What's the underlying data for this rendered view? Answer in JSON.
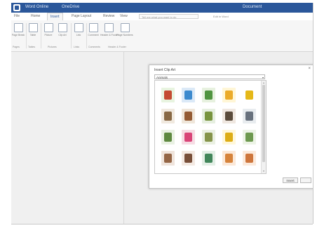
{
  "window": {
    "title": "Word Online",
    "document_name": "OneDrive",
    "right_label": "Document"
  },
  "tabs": [
    {
      "label": "File",
      "active": false
    },
    {
      "label": "Home",
      "active": false
    },
    {
      "label": "Insert",
      "active": true
    },
    {
      "label": "Page Layout",
      "active": false
    },
    {
      "label": "Review",
      "active": false
    },
    {
      "label": "View",
      "active": false
    }
  ],
  "search": {
    "placeholder": "Tell me what you want to do"
  },
  "account": {
    "signin_label": "",
    "share_label": "Edit in Word"
  },
  "ribbon": {
    "buttons": [
      {
        "label": "Page Break",
        "icon": "page-break-icon"
      },
      {
        "label": "Table",
        "icon": "table-icon"
      },
      {
        "label": "Picture",
        "icon": "picture-icon"
      },
      {
        "label": "Clip Art",
        "icon": "clip-art-icon"
      },
      {
        "label": "Link",
        "icon": "link-icon"
      },
      {
        "label": "Comment",
        "icon": "comment-icon"
      },
      {
        "label": "Header & Footer",
        "icon": "header-footer-icon"
      },
      {
        "label": "Page Numbers",
        "icon": "page-numbers-icon"
      }
    ],
    "groups": [
      {
        "label": "Pages"
      },
      {
        "label": "Tables"
      },
      {
        "label": "Pictures"
      },
      {
        "label": "Links"
      },
      {
        "label": "Comments"
      },
      {
        "label": "Header & Footer"
      }
    ]
  },
  "dialog": {
    "title": "Insert Clip Art",
    "close_glyph": "×",
    "category": "Animals",
    "insert_label": "Insert",
    "cancel_label": "",
    "clips": [
      {
        "bg": "#e8f4e0",
        "fg": "#c0391f"
      },
      {
        "bg": "#dbe9f7",
        "fg": "#2a7fc9"
      },
      {
        "bg": "#e7f1df",
        "fg": "#3f8a2f"
      },
      {
        "bg": "#fff6d6",
        "fg": "#e9a317"
      },
      {
        "bg": "#ffffff",
        "fg": "#e2b000"
      },
      {
        "bg": "#f0e9df",
        "fg": "#7c5a33"
      },
      {
        "bg": "#efe6da",
        "fg": "#8a4b21"
      },
      {
        "bg": "#e6efe0",
        "fg": "#6c8a2c"
      },
      {
        "bg": "#efe7e0",
        "fg": "#4a3b2a"
      },
      {
        "bg": "#e8ecef",
        "fg": "#5a6470"
      },
      {
        "bg": "#e9f1e3",
        "fg": "#4f7d2d"
      },
      {
        "bg": "#f6dce4",
        "fg": "#d6336c"
      },
      {
        "bg": "#eaf0e2",
        "fg": "#7a8a3a"
      },
      {
        "bg": "#fff7d9",
        "fg": "#d9a400"
      },
      {
        "bg": "#ecf3e6",
        "fg": "#5f8f3e"
      },
      {
        "bg": "#efe4dc",
        "fg": "#8a5634"
      },
      {
        "bg": "#f3e9e2",
        "fg": "#6a3e27"
      },
      {
        "bg": "#e3efe6",
        "fg": "#2f7a4a"
      },
      {
        "bg": "#fbe8d8",
        "fg": "#d2782a"
      },
      {
        "bg": "#fbeadc",
        "fg": "#c9692a"
      }
    ]
  },
  "theme": {
    "title_bar": "#2b579a",
    "accent": "#2b579a"
  }
}
